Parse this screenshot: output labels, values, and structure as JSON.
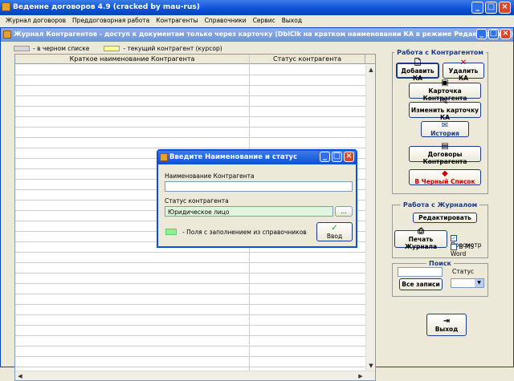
{
  "app": {
    "title": "Веденне договоров 4.9 (cracked by mau-rus)"
  },
  "menu": [
    "Журнал договоров",
    "Преддоговорная работа",
    "Контрагенты",
    "Справочники",
    "Сервис",
    "Выход"
  ],
  "journal": {
    "title": "Журнал Контрагентов - доступ к документам только через карточку (DblClk на кратком наименовании КА в режиме Редактировать)",
    "legend": {
      "black_label": "- в черном списке",
      "current_label": "- текущий контрагент (курсор)",
      "black_color": "#d8d8d8",
      "current_color": "#ffff99"
    },
    "columns": [
      "Краткое наименование Контрагента",
      "Статус контрагента"
    ]
  },
  "work_ka": {
    "title": "Работа с Контрагентом",
    "add": "Добавить КА",
    "delete": "Удалить КА",
    "card": "Карточка Контрагента",
    "edit_card": "Изменить карточку КА",
    "history": "История",
    "contracts": "Договоры Контрагента",
    "blacklist": "В Черный Список"
  },
  "work_journal": {
    "title": "Работа с Журналом",
    "edit": "Редактировать",
    "print": "Печать Журнала",
    "preview": "Просмотр",
    "ms_word": "В MS Word"
  },
  "search": {
    "title": "Поиск",
    "all": "Все записи",
    "status_label": "Статус"
  },
  "exit": "Выход",
  "dialog": {
    "title": "Введите Наименование и статус",
    "name_label": "Наименование Контрагента",
    "name_value": "",
    "status_label": "Статус контрагента",
    "status_value": "Юридическое лицо",
    "browse": "...",
    "required_note": "- Поля с заполнением из справочников",
    "ok": "Ввод",
    "required_color": "#90ee90"
  }
}
